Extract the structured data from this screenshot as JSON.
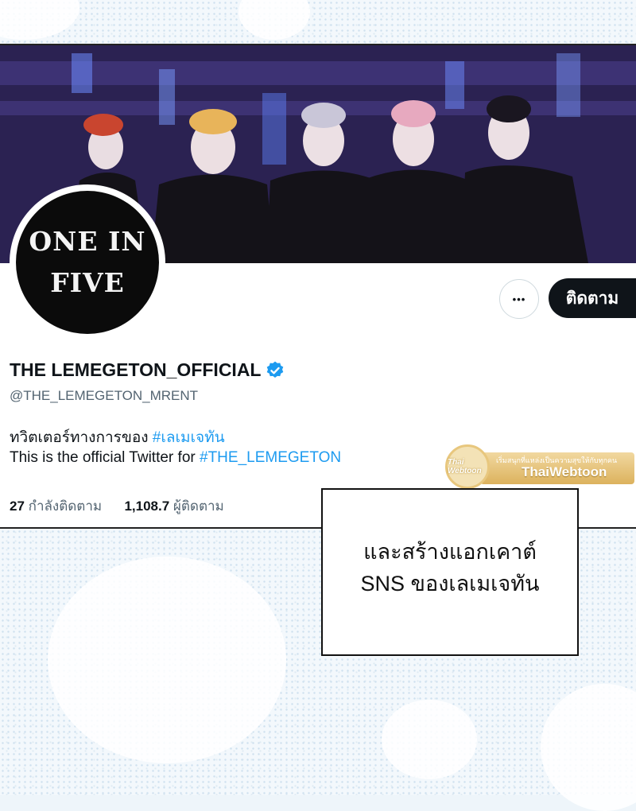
{
  "profile": {
    "avatar_lines": [
      "ONE IN",
      "FIVE"
    ],
    "display_name": "THE LEMEGETON_OFFICIAL",
    "handle": "@THE_LEMEGETON_MRENT",
    "bio_line1_text": "ทวิตเตอร์ทางการของ ",
    "bio_line1_tag": "#เลเมเจทัน",
    "bio_line2_text": "This is the official Twitter for ",
    "bio_line2_tag": "#THE_LEMEGETON",
    "following_count": "27",
    "following_label": "กำลังติดตาม",
    "followers_count": "1,108.7",
    "followers_label": "ผู้ติดตาม"
  },
  "actions": {
    "more_label": "•••",
    "follow_label": "ติดตาม"
  },
  "watermark": {
    "badge_text": "Thai Webtoon",
    "tagline": "เริ่มสนุกที่แหล่งเป็นความสุขให้กับทุกคน",
    "brand": "ThaiWebtoon"
  },
  "caption": {
    "line1": "และสร้างแอกเคาต์",
    "line2": "SNS ของเลเมเจทัน"
  },
  "colors": {
    "accent_blue": "#1d9bf0",
    "button_dark": "#0f1419",
    "muted_text": "#536471"
  },
  "icons": {
    "verified": "verified-badge-icon",
    "more": "more-dots-icon"
  }
}
